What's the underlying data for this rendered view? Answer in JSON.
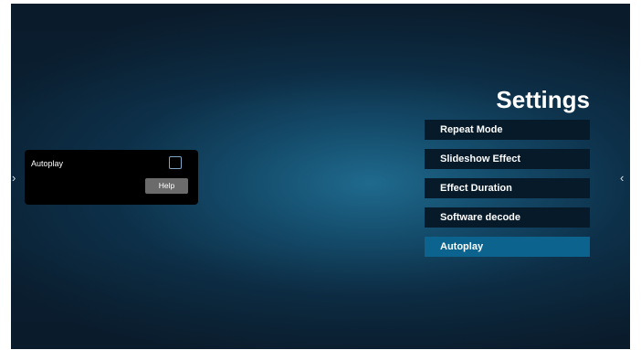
{
  "nav": {
    "left_arrow": "›",
    "right_arrow": "‹"
  },
  "popup": {
    "label": "Autoplay",
    "checkbox_checked": false,
    "help_label": "Help"
  },
  "settings": {
    "title": "Settings",
    "items": [
      {
        "label": "Repeat Mode",
        "selected": false
      },
      {
        "label": "Slideshow Effect",
        "selected": false
      },
      {
        "label": "Effect Duration",
        "selected": false
      },
      {
        "label": "Software decode",
        "selected": false
      },
      {
        "label": "Autoplay",
        "selected": true
      }
    ]
  },
  "colors": {
    "menu_item_bg": "#061a2a",
    "menu_item_selected_bg": "#0c638e",
    "checkbox_border": "#7fa6c6",
    "help_button_bg": "#6b6b6b"
  }
}
